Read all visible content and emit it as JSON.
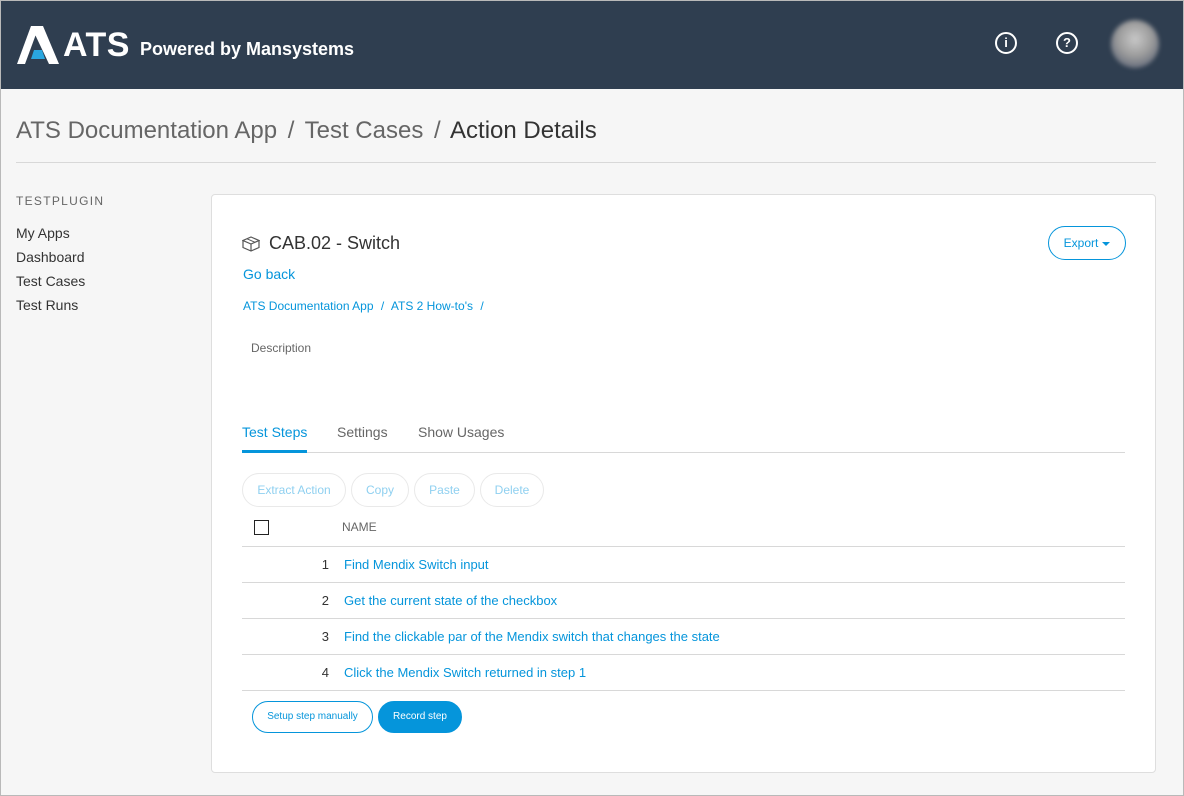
{
  "header": {
    "logo_text": "ATS",
    "logo_tagline": "Powered by Mansystems",
    "info_icon": "info-icon",
    "help_icon": "help-icon"
  },
  "page_title": {
    "crumbs": [
      "ATS Documentation App",
      "Test Cases"
    ],
    "separator": "/",
    "current": "Action Details"
  },
  "sidebar": {
    "header": "TESTPLUGIN",
    "items": [
      {
        "label": "My Apps"
      },
      {
        "label": "Dashboard"
      },
      {
        "label": "Test Cases"
      },
      {
        "label": "Test Runs"
      }
    ]
  },
  "action": {
    "icon": "cube-icon",
    "title": "CAB.02 - Switch",
    "go_back": "Go back",
    "export_label": "Export",
    "breadcrumbs": [
      "ATS Documentation App",
      "ATS 2 How-to's"
    ],
    "breadcrumb_separator": "/",
    "description_label": "Description"
  },
  "tabs": [
    {
      "label": "Test Steps",
      "active": true
    },
    {
      "label": "Settings",
      "active": false
    },
    {
      "label": "Show Usages",
      "active": false
    }
  ],
  "toolbar": {
    "extract_action": "Extract Action",
    "copy": "Copy",
    "paste": "Paste",
    "delete": "Delete"
  },
  "steps": {
    "column_name": "NAME",
    "rows": [
      {
        "num": "1",
        "name": "Find Mendix Switch input"
      },
      {
        "num": "2",
        "name": "Get the current state of the checkbox"
      },
      {
        "num": "3",
        "name": "Find the clickable par of the Mendix switch that changes the state"
      },
      {
        "num": "4",
        "name": "Click the Mendix Switch returned in step 1"
      }
    ]
  },
  "footer_buttons": {
    "setup_manually": "Setup step manually",
    "record_step": "Record step"
  },
  "colors": {
    "topbar": "#2f3e50",
    "accent": "#0595db",
    "page_bg": "#f6f6f6"
  }
}
